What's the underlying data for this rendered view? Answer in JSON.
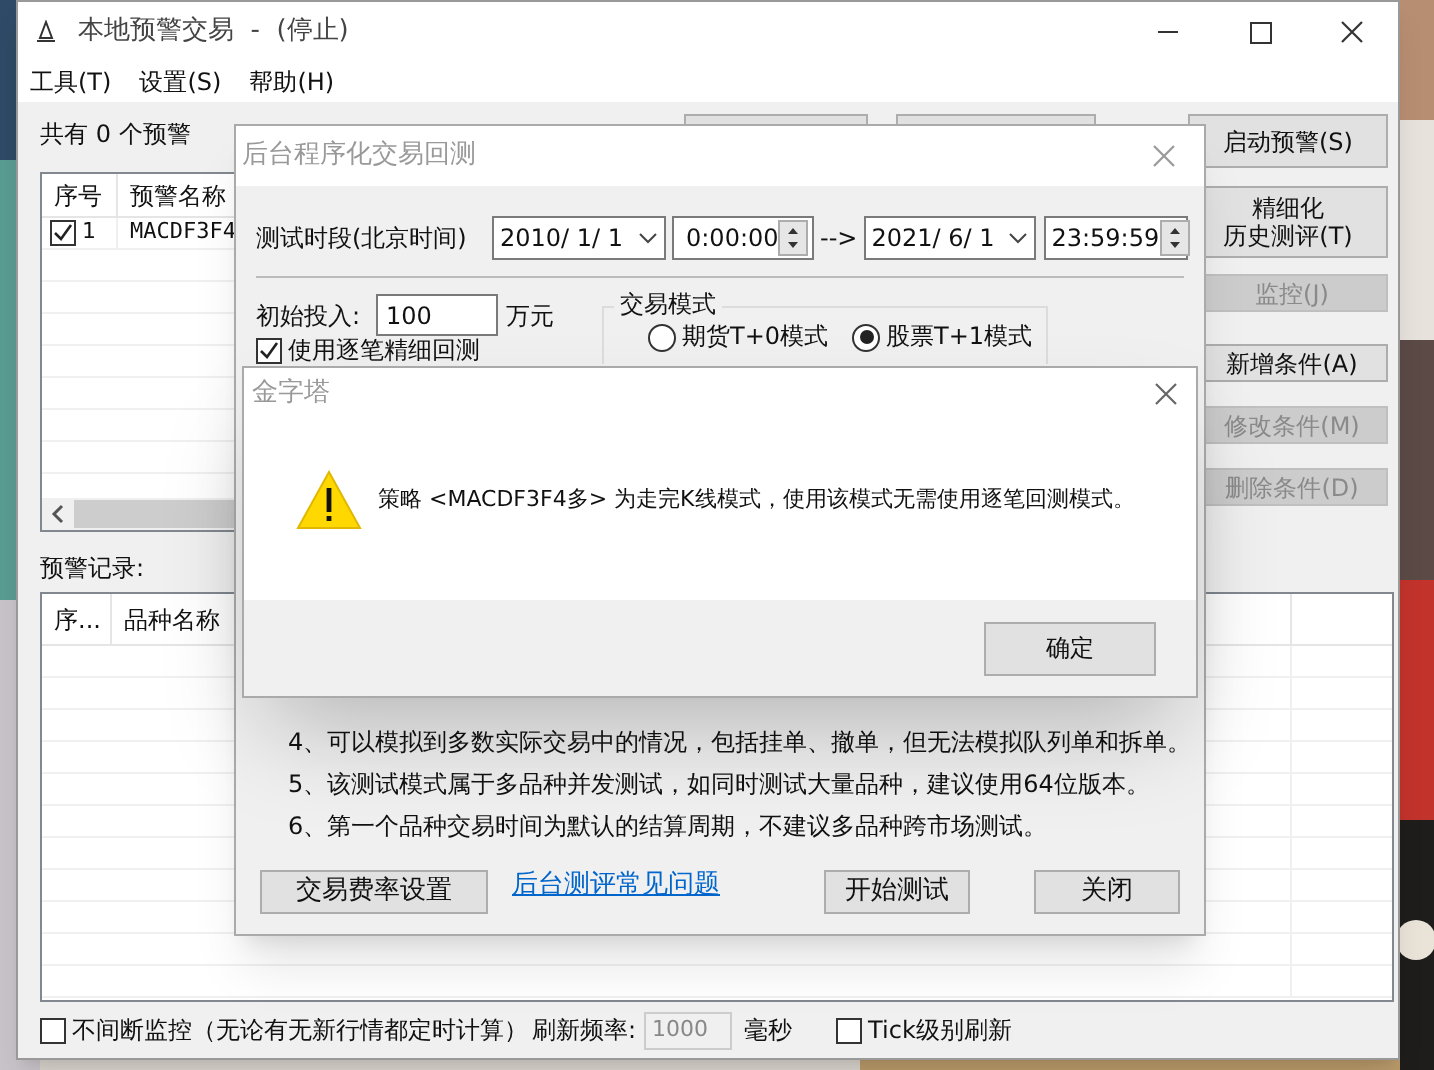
{
  "main_window": {
    "title": "本地预警交易  -  (停止)",
    "menu": [
      "工具(T)",
      "设置(S)",
      "帮助(H)"
    ],
    "alert_count": "共有 0 个预警",
    "buttons": [
      {
        "lines": [
          "启动预警(S)"
        ],
        "disabled": false
      },
      {
        "lines": [
          "精细化",
          "历史测评(T)"
        ],
        "disabled": false
      },
      {
        "lines": [
          "监控(J)"
        ],
        "disabled": true
      },
      {
        "lines": [
          "新增条件(A)"
        ],
        "disabled": false
      },
      {
        "lines": [
          "修改条件(M)"
        ],
        "disabled": true
      },
      {
        "lines": [
          "删除条件(D)"
        ],
        "disabled": true
      }
    ],
    "alert_table": {
      "columns": [
        "序号",
        "预警名称"
      ],
      "rows": [
        {
          "checked": true,
          "index": "1",
          "name": "MACDF3F4"
        }
      ]
    },
    "records_label": "预警记录:",
    "records_table": {
      "columns": [
        "序...",
        "品种名称"
      ]
    },
    "footer": {
      "continuous_monitor": {
        "label": "不间断监控（无论有无新行情都定时计算）",
        "checked": false
      },
      "refresh_label": "刷新频率:",
      "refresh_value": "1000",
      "unit": "毫秒",
      "tick_refresh": {
        "label": "Tick级别刷新",
        "checked": false
      }
    }
  },
  "backtest_dialog": {
    "title": "后台程序化交易回测",
    "period_label": "测试时段(北京时间)",
    "start_date": "2010/  1/  1",
    "start_time": "0:00:00",
    "arrow": "-->",
    "end_date": "2021/  6/  1",
    "end_time": "23:59:59",
    "capital_label": "初始投入:",
    "capital_value": "100",
    "capital_unit": "万元",
    "tick_detail": {
      "label": "使用逐笔精细回测",
      "checked": true
    },
    "mode_group": "交易模式",
    "modes": [
      {
        "label": "期货T+0模式",
        "selected": false
      },
      {
        "label": "股票T+1模式",
        "selected": true
      }
    ],
    "notes": [
      "4、可以模拟到多数实际交易中的情况，包括挂单、撤单，但无法模拟队列单和拆单。",
      "5、该测试模式属于多品种并发测试，如同时测试大量品种，建议使用64位版本。",
      "6、第一个品种交易时间为默认的结算周期，不建议多品种跨市场测试。"
    ],
    "fee_button": "交易费率设置",
    "faq_link": "后台测评常见问题",
    "start_button": "开始测试",
    "close_button": "关闭"
  },
  "message_box": {
    "title": "金字塔",
    "message": "策略 <MACDF3F4多> 为走完K线模式，使用该模式无需使用逐笔回测模式。",
    "ok_button": "确定"
  }
}
